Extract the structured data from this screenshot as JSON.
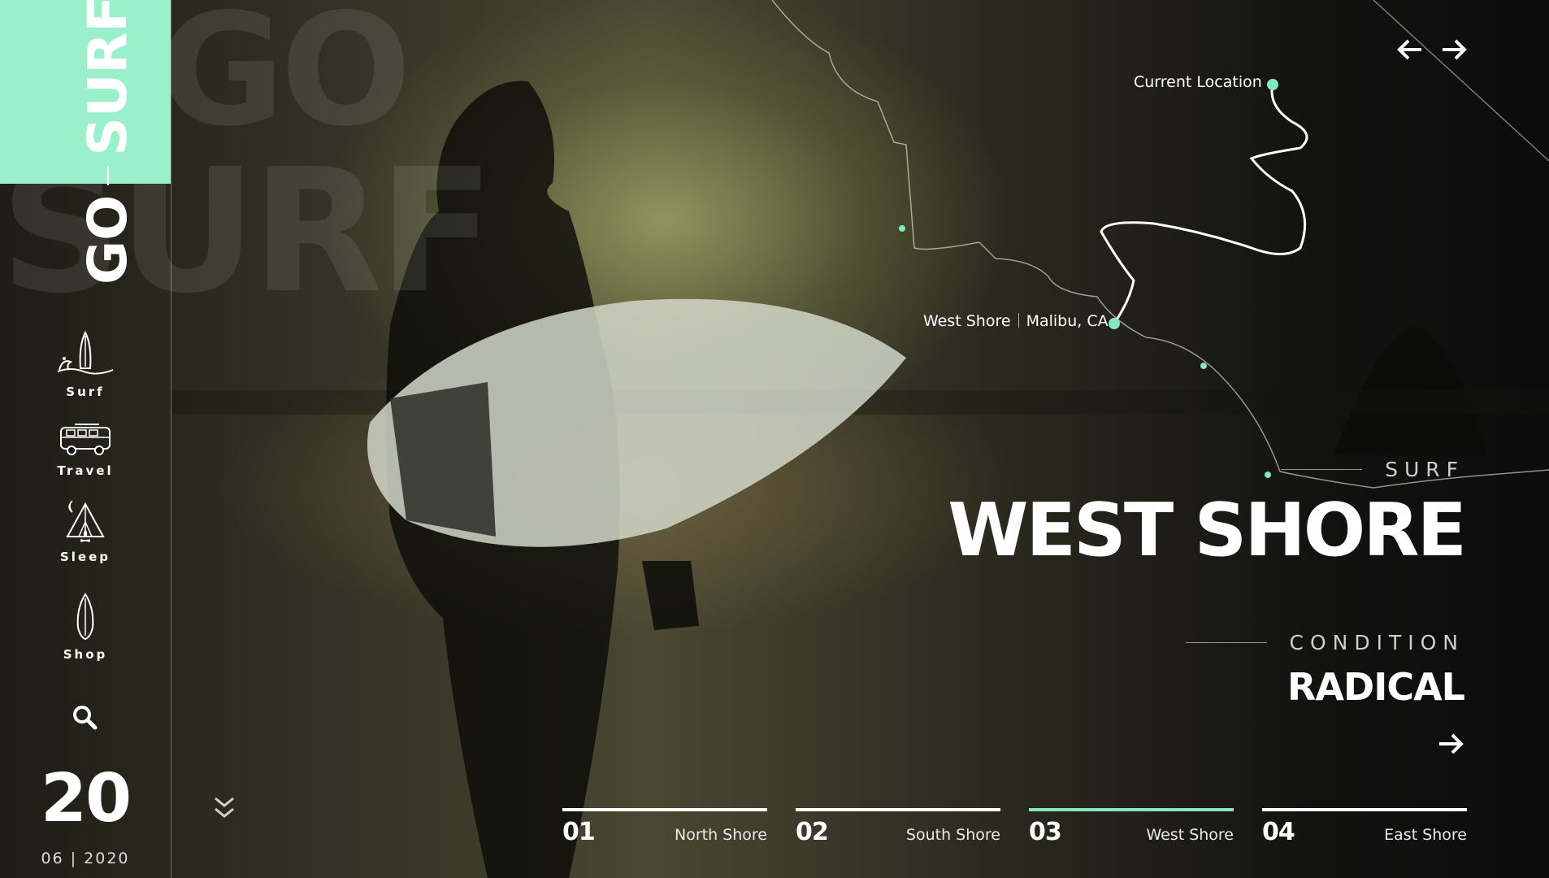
{
  "brand": {
    "go": "GO",
    "surf": "SURF",
    "accent_color": "#99f0cb"
  },
  "background_text": {
    "line1": "GO",
    "line2": "SURF"
  },
  "nav": [
    {
      "icon": "surf-wave-icon",
      "label": "Surf"
    },
    {
      "icon": "travel-van-icon",
      "label": "Travel"
    },
    {
      "icon": "camp-tent-icon",
      "label": "Sleep"
    },
    {
      "icon": "surfboard-icon",
      "label": "Shop"
    }
  ],
  "date": {
    "day": "20",
    "month_year": "06 | 2020"
  },
  "map": {
    "current_location": "Current Location",
    "spot_name": "West Shore",
    "spot_area": "Malibu, CA"
  },
  "hero": {
    "eyebrow": "SURF",
    "title": "WEST SHORE",
    "condition_label": "CONDITION",
    "condition_value": "RADICAL"
  },
  "tabs": [
    {
      "num": "01",
      "name": "North Shore",
      "active": false
    },
    {
      "num": "02",
      "name": "South Shore",
      "active": false
    },
    {
      "num": "03",
      "name": "West Shore",
      "active": true
    },
    {
      "num": "04",
      "name": "East Shore",
      "active": false
    }
  ]
}
